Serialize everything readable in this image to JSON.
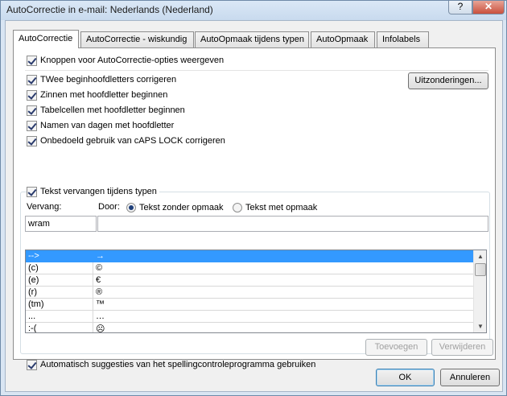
{
  "window": {
    "title": "AutoCorrectie in e-mail: Nederlands (Nederland)",
    "help_glyph": "?",
    "close_glyph": "✕"
  },
  "tabs": [
    {
      "label": "AutoCorrectie",
      "active": true
    },
    {
      "label": "AutoCorrectie - wiskundig"
    },
    {
      "label": "AutoOpmaak tijdens typen"
    },
    {
      "label": "AutoOpmaak"
    },
    {
      "label": "Infolabels"
    }
  ],
  "options": {
    "show_buttons": {
      "label": "Knoppen voor AutoCorrectie-opties weergeven",
      "checked": true
    },
    "two_caps": {
      "label": "TWee beginhoofdletters corrigeren",
      "checked": true
    },
    "sentence_caps": {
      "label": "Zinnen met hoofdletter beginnen",
      "checked": true
    },
    "table_caps": {
      "label": "Tabelcellen met hoofdletter beginnen",
      "checked": true
    },
    "day_names": {
      "label": "Namen van dagen met hoofdletter",
      "checked": true
    },
    "caps_lock": {
      "label": "Onbedoeld gebruik van cAPS LOCK corrigeren",
      "checked": true
    },
    "exceptions_button": "Uitzonderingen..."
  },
  "replace": {
    "enable_label": "Tekst vervangen tijdens typen",
    "enabled": true,
    "vervang_label": "Vervang:",
    "door_label": "Door:",
    "radio_plain": "Tekst zonder opmaak",
    "radio_formatted": "Tekst met opmaak",
    "plain_selected": true,
    "vervang_value": "wram",
    "door_value": "",
    "entries": [
      {
        "from": "-->",
        "to": "→",
        "selected": true
      },
      {
        "from": "(c)",
        "to": "©"
      },
      {
        "from": "(e)",
        "to": "€"
      },
      {
        "from": "(r)",
        "to": "®"
      },
      {
        "from": "(tm)",
        "to": "™"
      },
      {
        "from": "...",
        "to": "…"
      },
      {
        "from": ":-(",
        "to": "☹"
      }
    ],
    "add_button": "Toevoegen",
    "delete_button": "Verwijderen",
    "spell_label": "Automatisch suggesties van het spellingcontroleprogramma gebruiken",
    "spell_checked": true
  },
  "footer": {
    "ok": "OK",
    "cancel": "Annuleren"
  }
}
